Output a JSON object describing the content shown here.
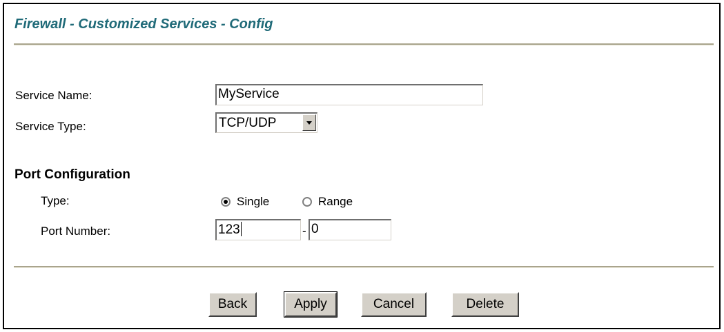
{
  "page": {
    "title": "Firewall - Customized Services - Config"
  },
  "form": {
    "service_name_label": "Service Name:",
    "service_name_value": "MyService",
    "service_type_label": "Service Type:",
    "service_type_value": "TCP/UDP",
    "port_config_heading": "Port Configuration",
    "type_label": "Type:",
    "type_options": [
      "Single",
      "Range"
    ],
    "type_selected": "Single",
    "port_number_label": "Port Number:",
    "port_start_value": "123",
    "port_separator": "-",
    "port_end_value": "0"
  },
  "buttons": {
    "back": "Back",
    "apply": "Apply",
    "cancel": "Cancel",
    "delete": "Delete"
  },
  "colors": {
    "title": "#1f6a78",
    "rule": "#a9a48d",
    "button_face": "#d4d0c8"
  },
  "icons": {
    "dropdown": "chevron-down-icon"
  }
}
